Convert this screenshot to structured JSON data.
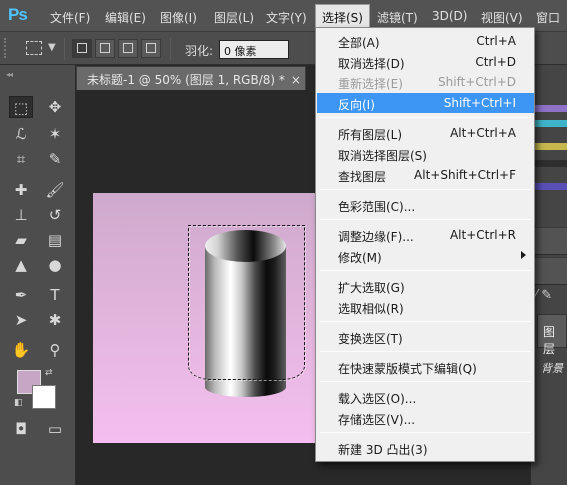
{
  "menubar": {
    "logo": "Ps",
    "items": [
      "文件(F)",
      "编辑(E)",
      "图像(I)",
      "图层(L)",
      "文字(Y)",
      "选择(S)",
      "滤镜(T)",
      "3D(D)",
      "视图(V)",
      "窗口"
    ]
  },
  "options": {
    "feather_label": "羽化:",
    "feather_value": "0 像素"
  },
  "document": {
    "tab_title": "未标题-1 @ 50% (图层 1, RGB/8) *",
    "close_glyph": "×"
  },
  "toolbar": {
    "foreground_color": "#c7a5c4",
    "background_color": "#ffffff",
    "tools": [
      {
        "name": "rectangular-marquee-tool",
        "glyph": "⬚"
      },
      {
        "name": "move-tool",
        "glyph": "✥"
      },
      {
        "name": "lasso-tool",
        "glyph": "ℒ"
      },
      {
        "name": "magic-wand-tool",
        "glyph": "✶"
      },
      {
        "name": "crop-tool",
        "glyph": "⌗"
      },
      {
        "name": "eyedropper-tool",
        "glyph": "✎"
      },
      {
        "name": "spot-healing-tool",
        "glyph": "✚"
      },
      {
        "name": "brush-tool",
        "glyph": "🖌"
      },
      {
        "name": "clone-stamp-tool",
        "glyph": "⊥"
      },
      {
        "name": "history-brush-tool",
        "glyph": "↺"
      },
      {
        "name": "eraser-tool",
        "glyph": "▰"
      },
      {
        "name": "gradient-tool",
        "glyph": "▤"
      },
      {
        "name": "blur-tool",
        "glyph": "▲"
      },
      {
        "name": "dodge-tool",
        "glyph": "●"
      },
      {
        "name": "pen-tool",
        "glyph": "✒"
      },
      {
        "name": "type-tool",
        "glyph": "T"
      },
      {
        "name": "path-selection-tool",
        "glyph": "➤"
      },
      {
        "name": "custom-shape-tool",
        "glyph": "✱"
      },
      {
        "name": "hand-tool",
        "glyph": "✋"
      },
      {
        "name": "zoom-tool",
        "glyph": "⚲"
      }
    ]
  },
  "select_menu": {
    "items": [
      {
        "label": "全部(A)",
        "shortcut": "Ctrl+A",
        "state": "normal"
      },
      {
        "label": "取消选择(D)",
        "shortcut": "Ctrl+D",
        "state": "normal"
      },
      {
        "label": "重新选择(E)",
        "shortcut": "Shift+Ctrl+D",
        "state": "disabled"
      },
      {
        "label": "反向(I)",
        "shortcut": "Shift+Ctrl+I",
        "state": "highlighted"
      },
      {
        "label": "所有图层(L)",
        "shortcut": "Alt+Ctrl+A",
        "state": "normal"
      },
      {
        "label": "取消选择图层(S)",
        "shortcut": "",
        "state": "normal"
      },
      {
        "label": "查找图层",
        "shortcut": "Alt+Shift+Ctrl+F",
        "state": "normal"
      },
      {
        "label": "色彩范围(C)...",
        "shortcut": "",
        "state": "normal"
      },
      {
        "label": "调整边缘(F)...",
        "shortcut": "Alt+Ctrl+R",
        "state": "normal"
      },
      {
        "label": "修改(M)",
        "shortcut": "",
        "state": "submenu"
      },
      {
        "label": "扩大选取(G)",
        "shortcut": "",
        "state": "normal"
      },
      {
        "label": "选取相似(R)",
        "shortcut": "",
        "state": "normal"
      },
      {
        "label": "变换选区(T)",
        "shortcut": "",
        "state": "normal"
      },
      {
        "label": "在快速蒙版模式下编辑(Q)",
        "shortcut": "",
        "state": "normal"
      },
      {
        "label": "载入选区(O)...",
        "shortcut": "",
        "state": "normal"
      },
      {
        "label": "存储选区(V)...",
        "shortcut": "",
        "state": "normal"
      },
      {
        "label": "新建 3D 凸出(3)",
        "shortcut": "",
        "state": "normal"
      }
    ]
  },
  "right_panel": {
    "layers_tab": "图层",
    "layer_label": "背景"
  }
}
